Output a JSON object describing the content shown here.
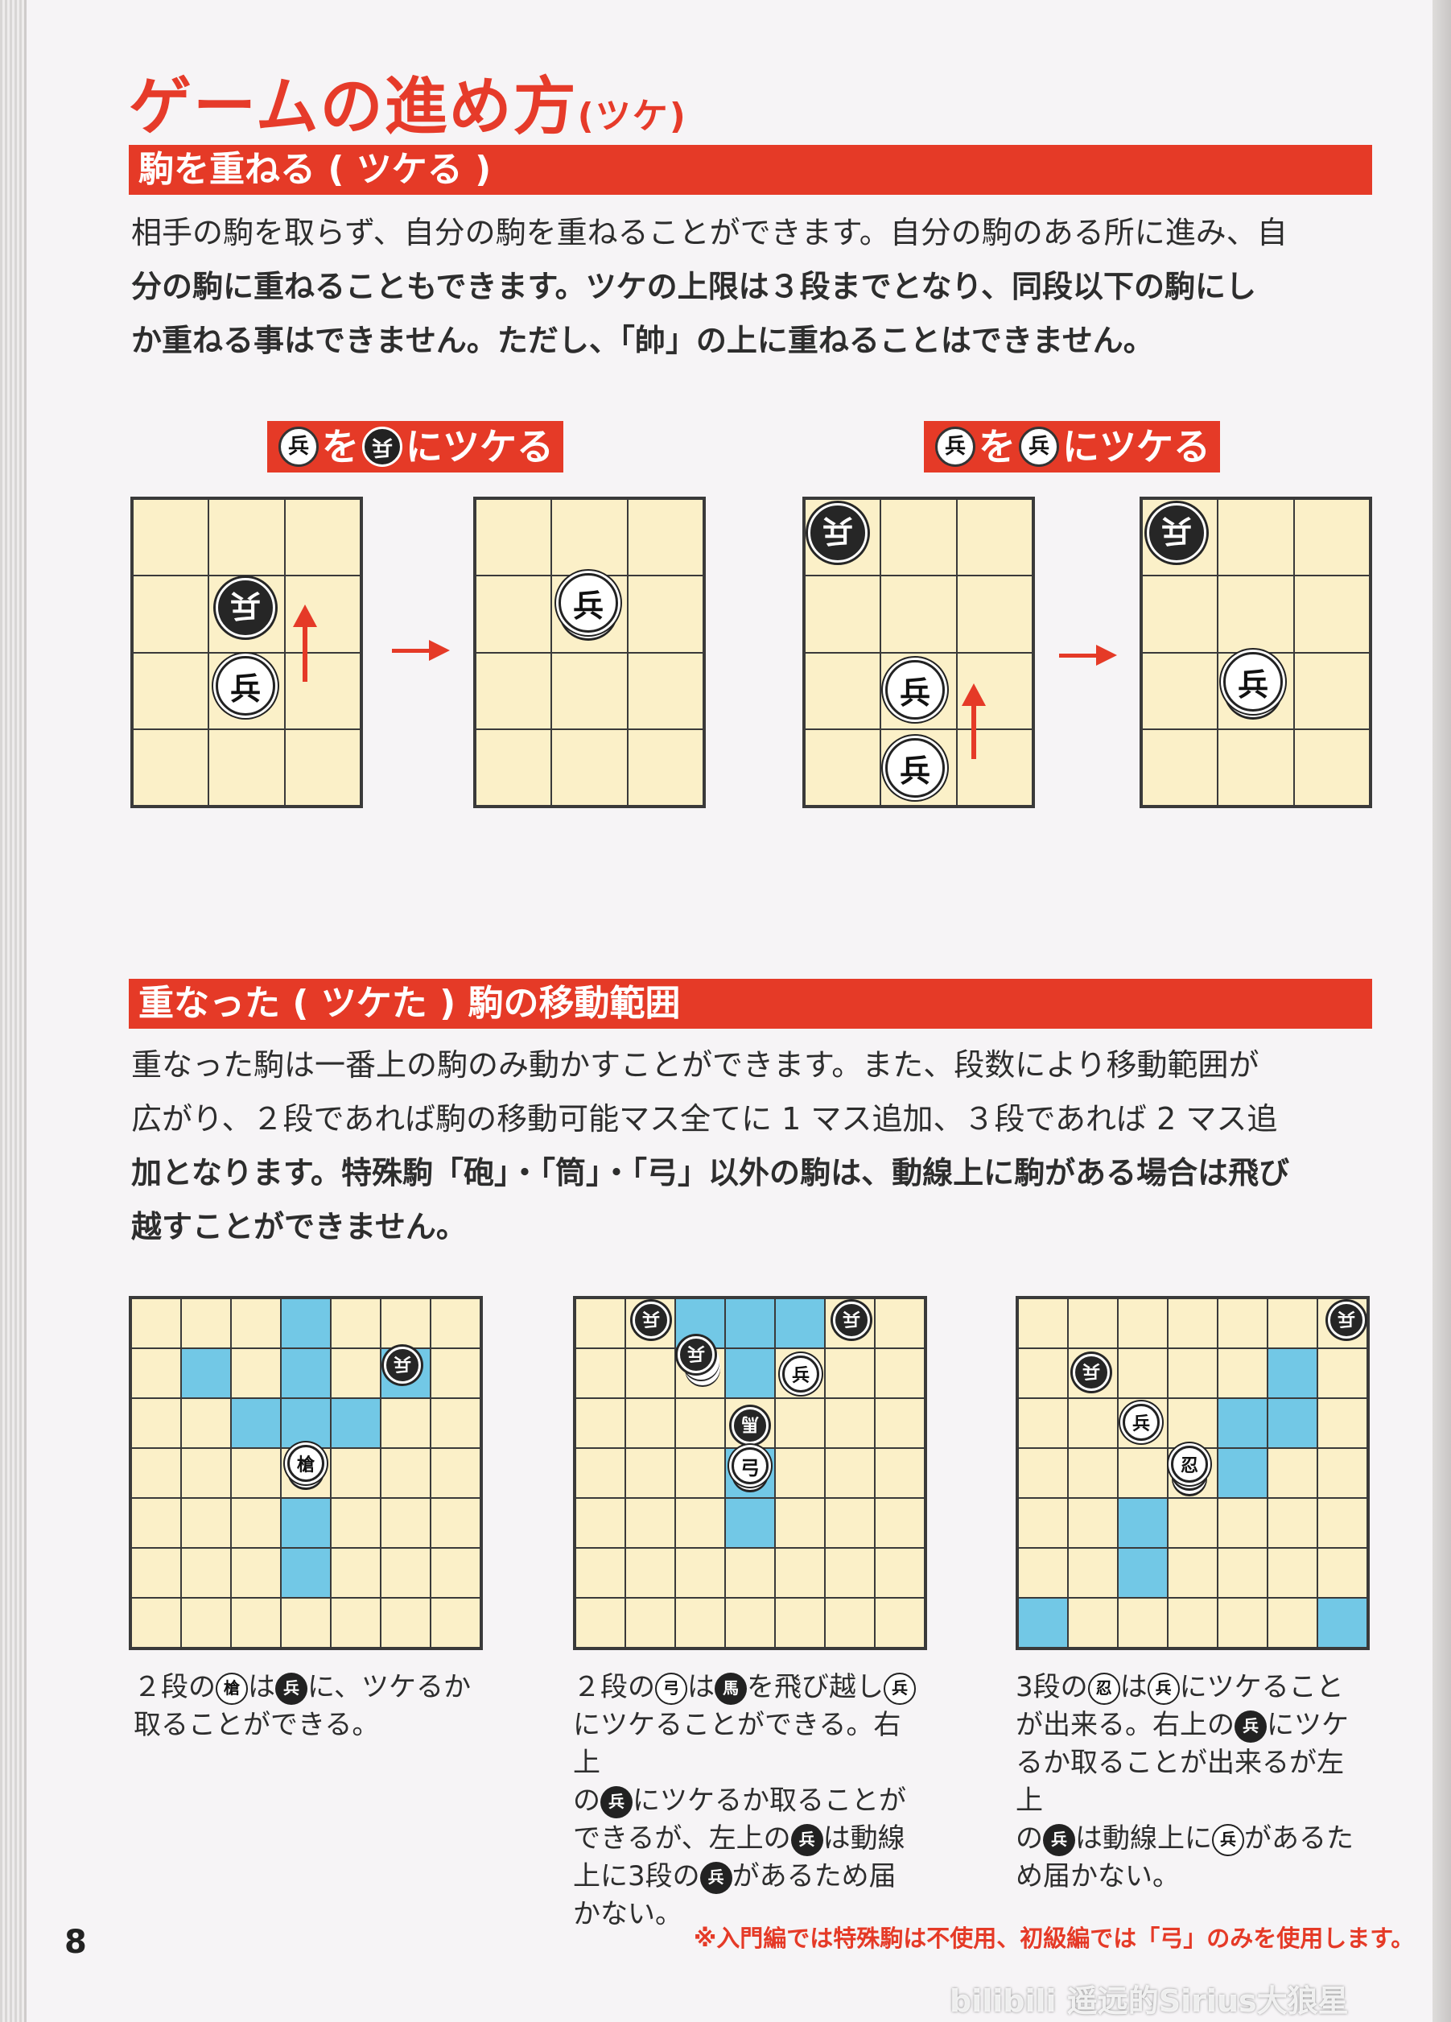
{
  "title": {
    "main": "ゲームの進め方",
    "suffix": "(ツケ)"
  },
  "section1": {
    "heading": "駒を重ねる ( ツケる )",
    "lines": [
      "相手の駒を取らず、自分の駒を重ねることができます。自分の駒のある所に進み、自",
      "分の駒に重ねることもできます。ツケの上限は３段までとなり、同段以下の駒にし",
      "か重ねる事はできません。ただし、「帥」の上に重ねることはできません。"
    ],
    "caption_left": {
      "chip1": "兵",
      "mid": "を",
      "chip2": "兵",
      "tail": "にツケる"
    },
    "caption_right": {
      "chip1": "兵",
      "mid": "を",
      "chip2": "兵",
      "tail": "にツケる"
    }
  },
  "section2": {
    "heading": "重なった ( ツケた ) 駒の移動範囲",
    "lines": [
      "重なった駒は一番上の駒のみ動かすことができます。また、段数により移動範囲が",
      "広がり、２段であれば駒の移動可能マス全てに 1 マス追加、３段であれば 2 マス追",
      "加となります。特殊駒「砲」・「筒」・「弓」以外の駒は、動線上に駒がある場合は飛び",
      "越すことができません。"
    ]
  },
  "pieces": {
    "hei": "兵",
    "yari": "槍",
    "yumi": "弓",
    "uma": "馬",
    "shinobi": "忍",
    "tsutsu": "筒"
  },
  "notes": {
    "left": [
      "２段の",
      "は",
      "に、ツケるか",
      "取ることができる。"
    ],
    "middle": [
      "２段の",
      "は",
      "を飛び越し",
      "にツケることができる。右上",
      "の",
      "にツケるか取ることが",
      "できるが、左上の",
      "は動線",
      "上に3段の",
      "があるため届",
      "かない。"
    ],
    "right": [
      "3段の",
      "は",
      "にツケること",
      "が出来る。右上の",
      "にツケ",
      "るか取ることが出来るが左上",
      "の",
      "は動線上に",
      "があるた",
      "め届かない。"
    ]
  },
  "page_number": "8",
  "footnote": "※入門編では特殊駒は不使用、初級編では「弓」のみを使用します。",
  "watermark": "bilibili 遥远的Sirius大狼星",
  "colors": {
    "accent": "#e53a27",
    "board": "#fbf0c8",
    "highlight": "#72c8e6"
  }
}
